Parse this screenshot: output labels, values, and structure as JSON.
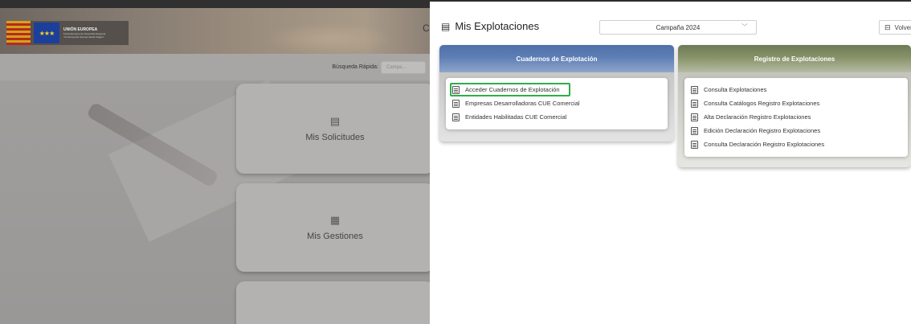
{
  "header": {
    "eu_title": "UNIÓN EUROPEA",
    "eu_subtitle_1": "Fondo Europeo de Desarrollo Regional",
    "eu_subtitle_2": "\"Construyendo Europa desde Aragón\"",
    "edge_char": "C"
  },
  "quick_search": {
    "label": "Búsqueda Rápida:",
    "select_value": "Campa..."
  },
  "background_cards": [
    {
      "label": "Mis Solicitudes",
      "icon": "list-doc-icon"
    },
    {
      "label": "Mis Gestiones",
      "icon": "doc-badge-icon"
    }
  ],
  "modal": {
    "title": "Mis Explotaciones",
    "campaign": "Campaña 2024",
    "back_label": "Volver",
    "sections": [
      {
        "title": "Cuadernos de Explotación",
        "items": [
          "Acceder Cuadernos de Explotación",
          "Empresas Desarrolladoras CUE Comercial",
          "Entidades Habilitadas CUE Comercial"
        ]
      },
      {
        "title": "Registro de Explotaciones",
        "items": [
          "Consulta Explotaciones",
          "Consulta Catálogos Registro Explotaciones",
          "Alta Declaración Registro Explotaciones",
          "Edición Declaración Registro Explotaciones",
          "Consulta Declaración Registro Explotaciones"
        ]
      }
    ]
  },
  "colors": {
    "highlight": "#2fae4a",
    "cuadernos_header": "#5e7eb6",
    "registro_header": "#879268"
  }
}
